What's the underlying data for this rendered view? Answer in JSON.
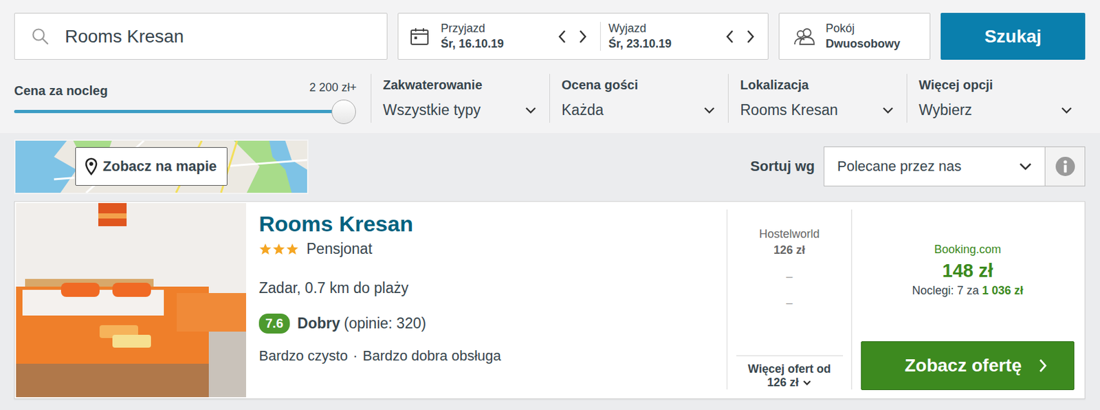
{
  "search": {
    "value": "Rooms Kresan"
  },
  "dates": [
    {
      "label": "Przyjazd",
      "value": "Śr, 16.10.19"
    },
    {
      "label": "Wyjazd",
      "value": "Śr, 23.10.19"
    }
  ],
  "room": {
    "label": "Pokój",
    "value": "Dwuosobowy"
  },
  "search_button": "Szukaj",
  "price_filter": {
    "label": "Cena za nocleg",
    "reading": "2 200 zł+",
    "level": 1
  },
  "filters": [
    {
      "label": "Zakwaterowanie",
      "value": "Wszystkie typy"
    },
    {
      "label": "Ocena gości",
      "value": "Każda"
    },
    {
      "label": "Lokalizacja",
      "value": "Rooms Kresan"
    },
    {
      "label": "Więcej opcji",
      "value": "Wybierz"
    }
  ],
  "map_button": "Zobacz na mapie",
  "sort": {
    "label": "Sortuj wg",
    "value": "Polecane przez nas"
  },
  "hotel": {
    "name": "Rooms Kresan",
    "stars": 3,
    "type": "Pensjonat",
    "location": "Zadar, 0.7 km do plaży",
    "rating": "7.6",
    "rating_label": "Dobry",
    "reviews": "(opinie: 320)",
    "highlights": [
      "Bardzo czysto",
      "Bardzo dobra obsługa"
    ],
    "highlight_separator": "·"
  },
  "side_offers": [
    {
      "kind": "offer",
      "provider": "Hostelworld",
      "price": "126 zł"
    },
    {
      "kind": "empty",
      "text": "–"
    },
    {
      "kind": "empty",
      "text": "–"
    }
  ],
  "more_offers": {
    "label": "Więcej ofert od",
    "price": "126 zł"
  },
  "main_offer": {
    "provider": "Booking.com",
    "price": "148 zł",
    "nights": "Noclegi: 7 za",
    "total": "1 036 zł",
    "button": "Zobacz ofertę"
  }
}
